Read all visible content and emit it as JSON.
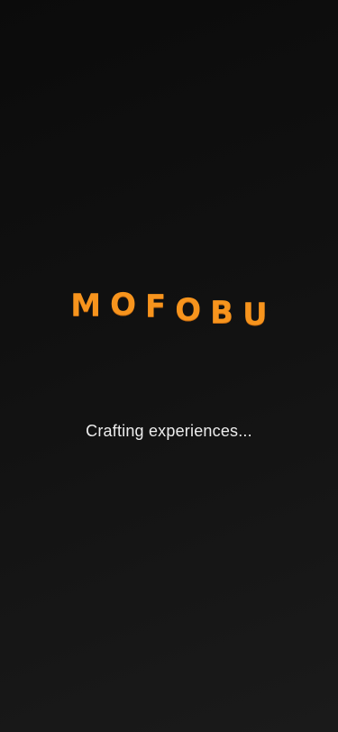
{
  "splash": {
    "logo_letters": [
      "M",
      "O",
      "F",
      "O",
      "B",
      "U"
    ],
    "tagline": "Crafting experiences...",
    "accent_color": "#f7941d",
    "background_color": "#111111"
  }
}
